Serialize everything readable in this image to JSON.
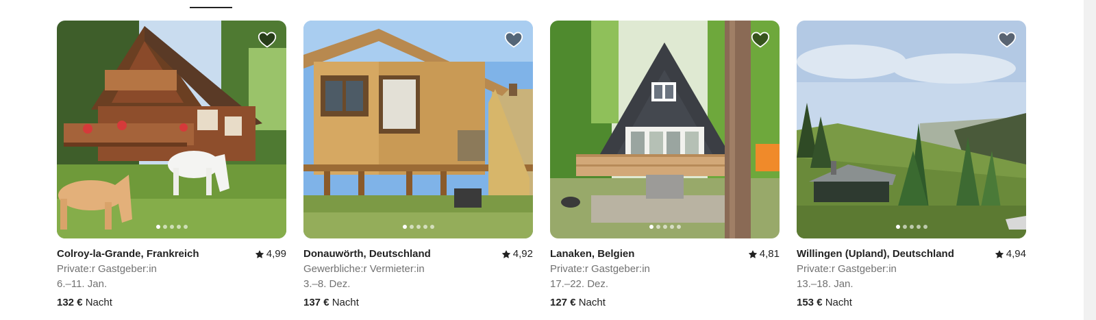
{
  "colors": {
    "text_primary": "#222222",
    "text_secondary": "#717171",
    "heart_fill": "rgba(0,0,0,0.5)",
    "heart_stroke": "#ffffff"
  },
  "listings": [
    {
      "location": "Colroy-la-Grande, Frankreich",
      "rating": "4,99",
      "host_type": "Private:r Gastgeber:in",
      "dates": "6.–11. Jan.",
      "price": "132 €",
      "price_unit": "Nacht",
      "photo_icon": "chalet-horses-photo",
      "dots": 5,
      "active_dot": 0
    },
    {
      "location": "Donauwörth, Deutschland",
      "rating": "4,92",
      "host_type": "Gewerbliche:r Vermieter:in",
      "dates": "3.–8. Dez.",
      "price": "137 €",
      "price_unit": "Nacht",
      "photo_icon": "wooden-cabin-photo",
      "dots": 5,
      "active_dot": 0
    },
    {
      "location": "Lanaken, Belgien",
      "rating": "4,81",
      "host_type": "Private:r Gastgeber:in",
      "dates": "17.–22. Dez.",
      "price": "127 €",
      "price_unit": "Nacht",
      "photo_icon": "a-frame-house-photo",
      "dots": 5,
      "active_dot": 0
    },
    {
      "location": "Willingen (Upland), Deutschland",
      "rating": "4,94",
      "host_type": "Private:r Gastgeber:in",
      "dates": "13.–18. Jan.",
      "price": "153 €",
      "price_unit": "Nacht",
      "photo_icon": "mountain-cabin-photo",
      "dots": 5,
      "active_dot": 0
    }
  ]
}
